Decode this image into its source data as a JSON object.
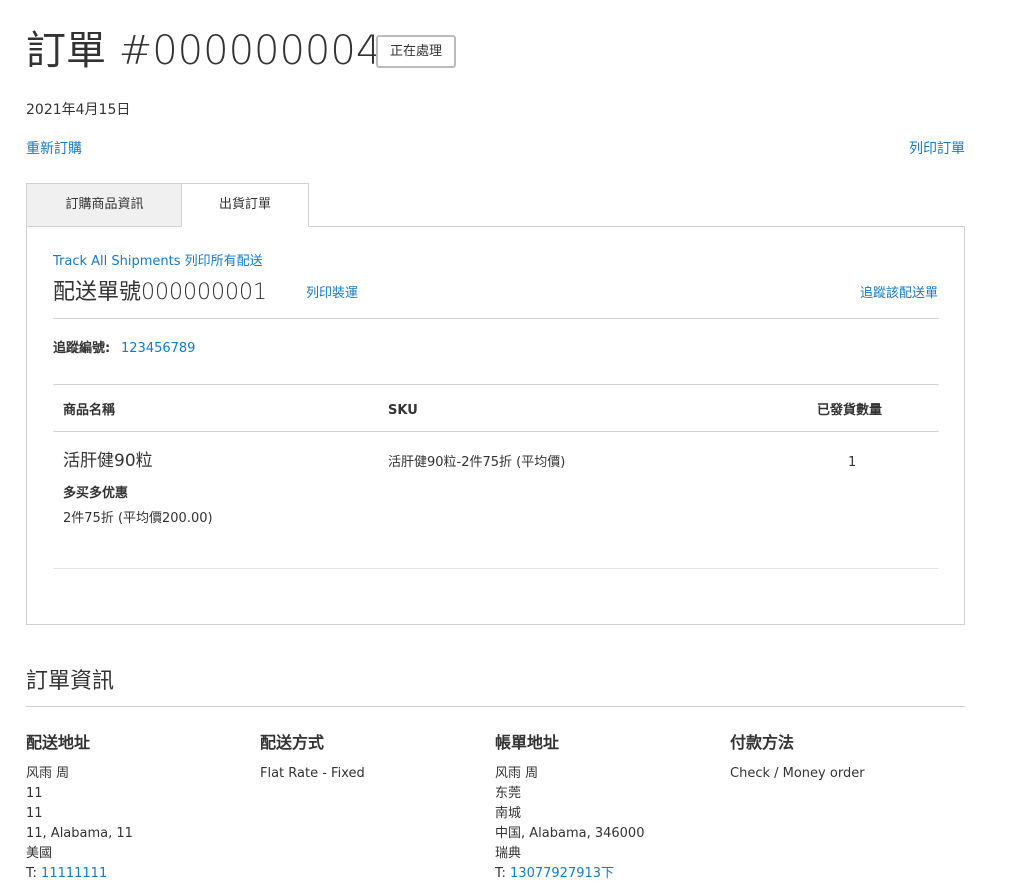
{
  "header": {
    "title": "訂單 #000000004",
    "status": "正在處理",
    "date": "2021年4月15日",
    "reorder": "重新訂購",
    "print_order": "列印訂單"
  },
  "tabs": [
    {
      "label": "訂購商品資訊",
      "active": false
    },
    {
      "label": "出貨訂單",
      "active": true
    }
  ],
  "shipment": {
    "track_all": "Track All Shipments",
    "print_all": "列印所有配送",
    "title": "配送單號000000001",
    "print_shipment": "列印裝運",
    "track_shipment": "追蹤該配送單",
    "tracking_label": "追蹤編號:",
    "tracking_number": "123456789",
    "columns": {
      "name": "商品名稱",
      "sku": "SKU",
      "qty": "已發貨數量"
    },
    "items": [
      {
        "name": "活肝健90粒",
        "sku": "活肝健90粒-2件75折 (平均價)",
        "qty": "1",
        "option_label": "多买多优惠",
        "option_value": "2件75折 (平均價200.00)"
      }
    ]
  },
  "order_info": {
    "title": "訂單資訊",
    "shipping_address": {
      "heading": "配送地址",
      "name": "风雨 周",
      "street1": "11",
      "street2": "11",
      "city_region": "11, Alabama, 11",
      "country": "美國",
      "phone_prefix": "T:",
      "phone": "11111111"
    },
    "shipping_method": {
      "heading": "配送方式",
      "value": "Flat Rate - Fixed"
    },
    "billing_address": {
      "heading": "帳單地址",
      "name": "风雨 周",
      "street1": "东莞",
      "street2": "南城",
      "city_region": "中国, Alabama, 346000",
      "country": "瑞典",
      "phone_prefix": "T:",
      "phone": "13077927913下"
    },
    "payment_method": {
      "heading": "付款方法",
      "value": "Check / Money order"
    }
  },
  "colors": {
    "link": "#1979c3",
    "text": "#333333",
    "border": "#d1d1d1"
  }
}
